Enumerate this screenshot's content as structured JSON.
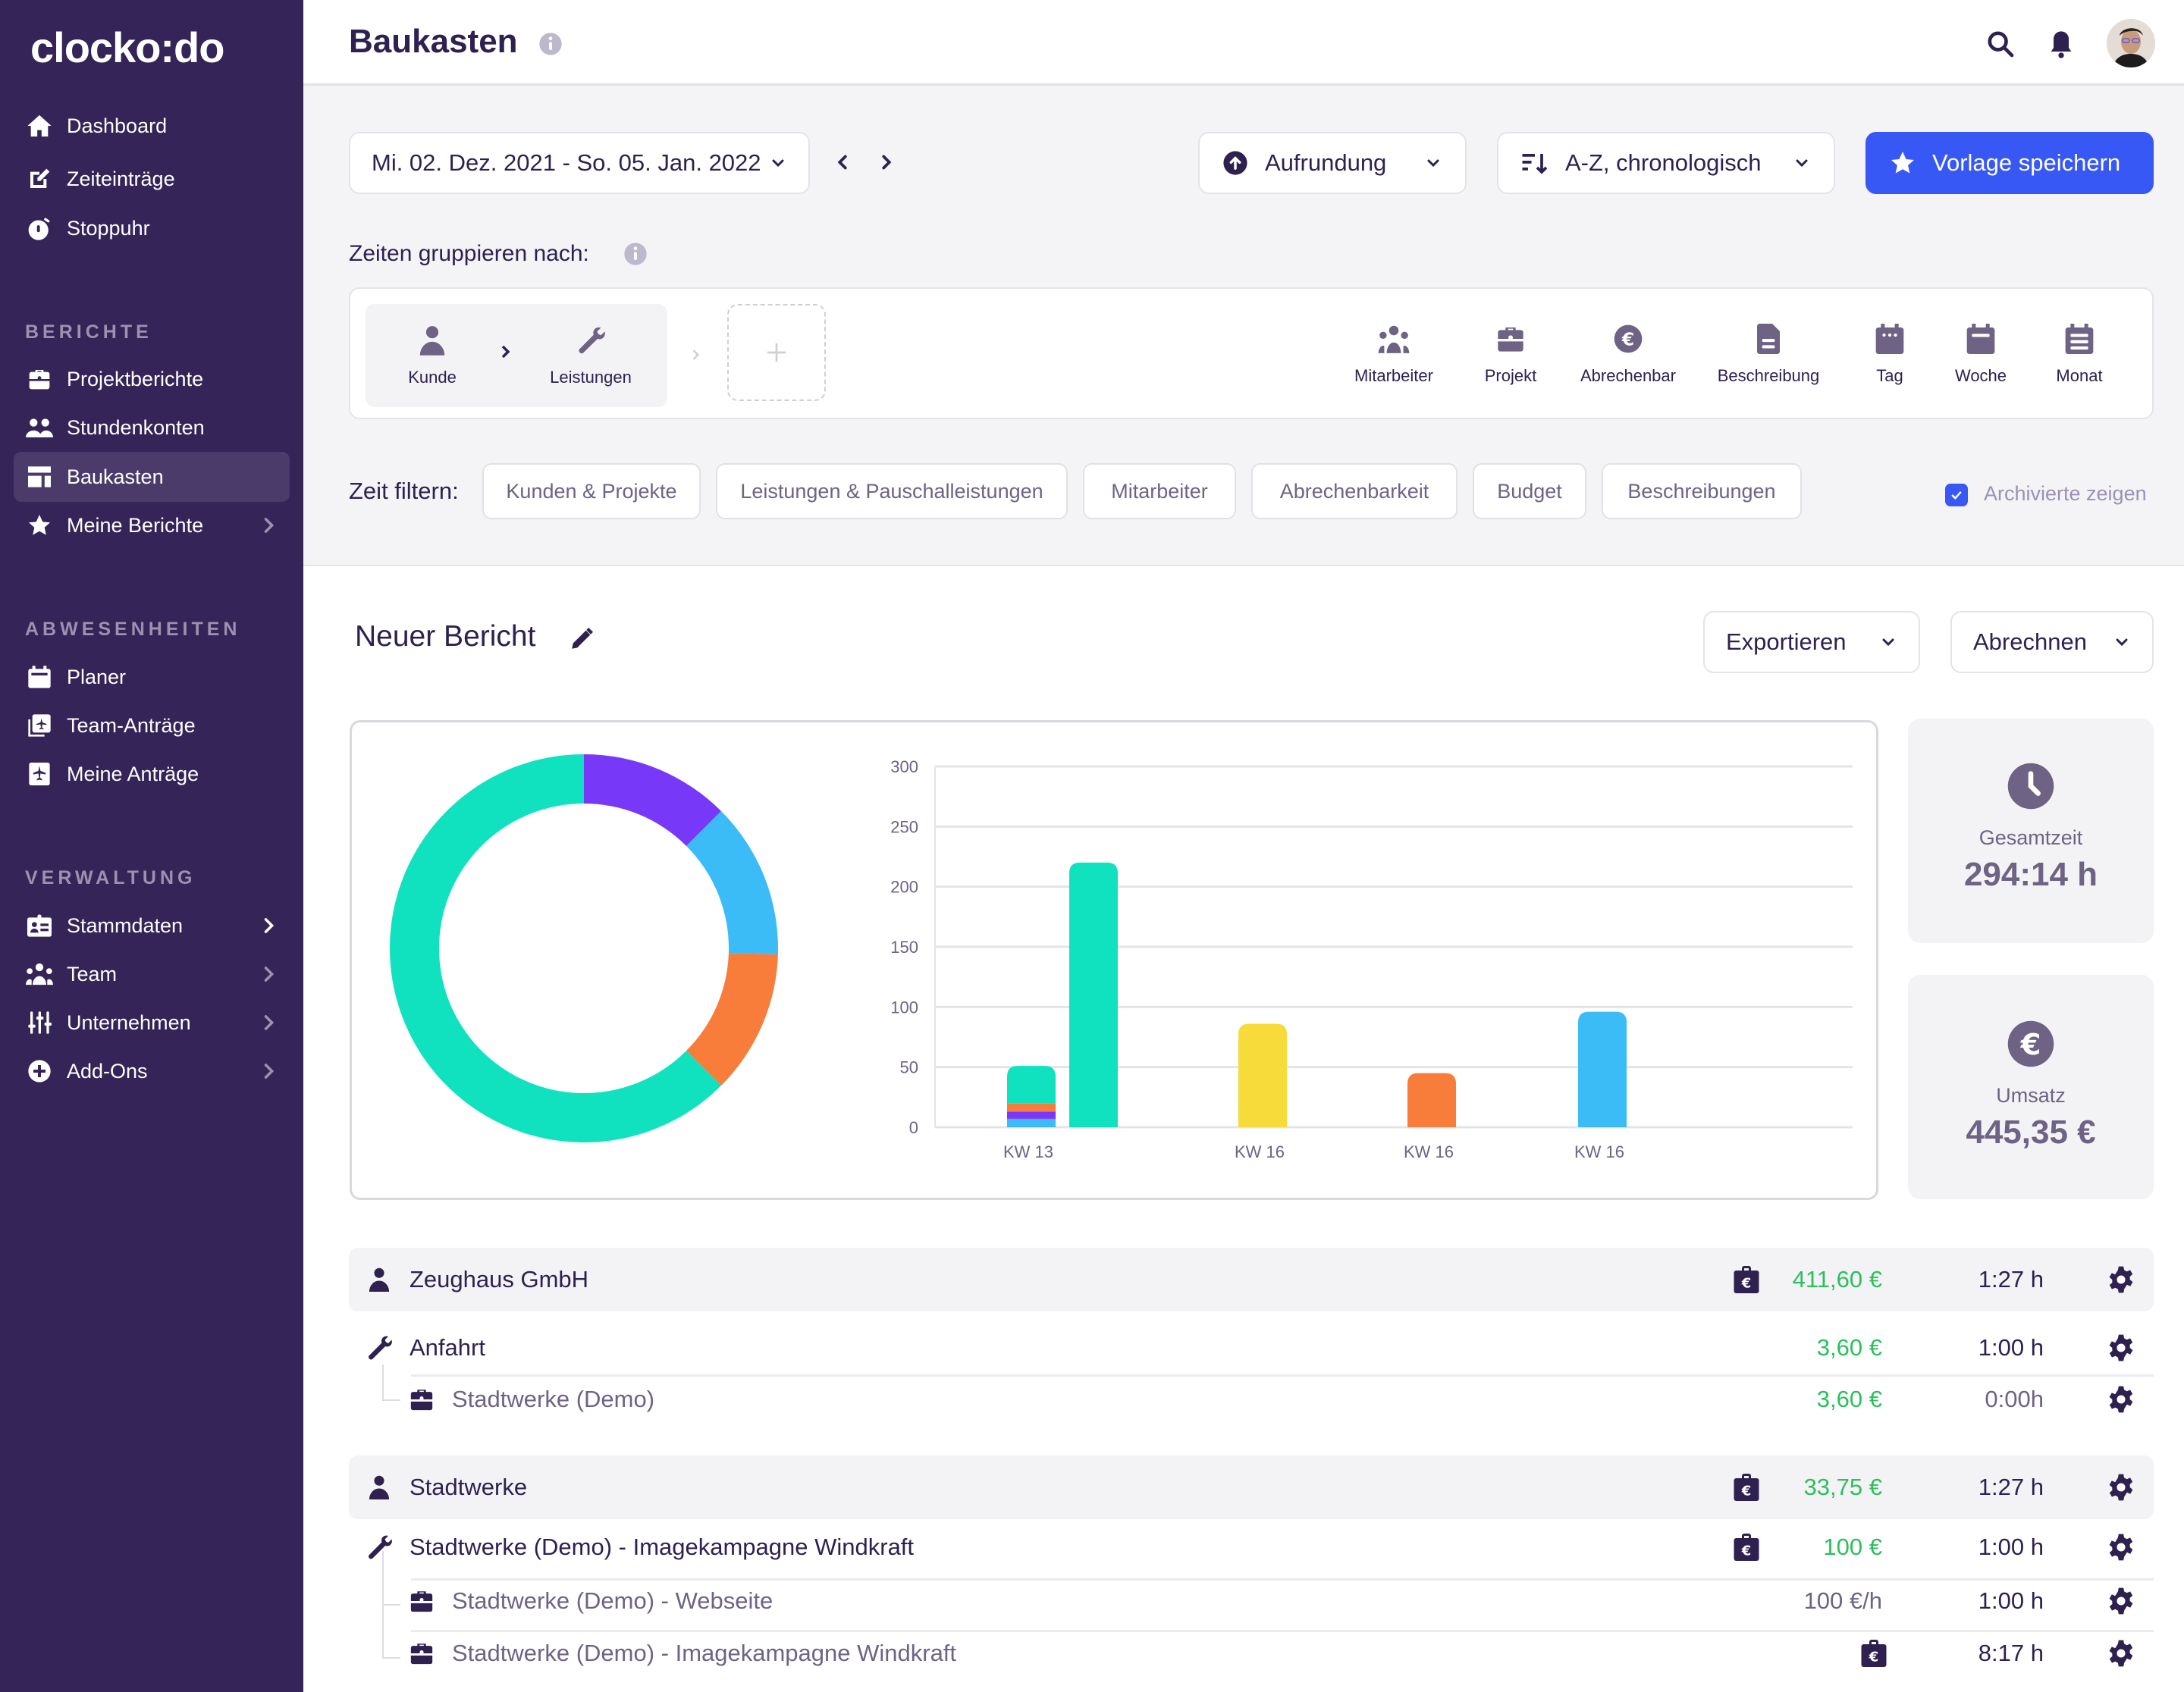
{
  "app": {
    "logo": "clocko:do",
    "page_title": "Baukasten"
  },
  "sidebar": {
    "main": [
      {
        "label": "Dashboard",
        "icon": "home-icon"
      },
      {
        "label": "Zeiteinträge",
        "icon": "edit-icon"
      },
      {
        "label": "Stoppuhr",
        "icon": "stopwatch-icon"
      }
    ],
    "sections": [
      {
        "title": "BERICHTE",
        "items": [
          {
            "label": "Projektberichte",
            "icon": "briefcase-icon"
          },
          {
            "label": "Stundenkonten",
            "icon": "users-icon"
          },
          {
            "label": "Baukasten",
            "icon": "layout-icon",
            "active": true
          },
          {
            "label": "Meine Berichte",
            "icon": "star-icon",
            "chevron": true
          }
        ]
      },
      {
        "title": "ABWESENHEITEN",
        "items": [
          {
            "label": "Planer",
            "icon": "calendar-icon"
          },
          {
            "label": "Team-Anträge",
            "icon": "team-requests-icon"
          },
          {
            "label": "Meine Anträge",
            "icon": "plane-icon"
          }
        ]
      },
      {
        "title": "VERWALTUNG",
        "items": [
          {
            "label": "Stammdaten",
            "icon": "id-card-icon",
            "chevron": true
          },
          {
            "label": "Team",
            "icon": "team-icon",
            "chevron": true
          },
          {
            "label": "Unternehmen",
            "icon": "sliders-icon",
            "chevron": true
          },
          {
            "label": "Add-Ons",
            "icon": "plus-circle-icon",
            "chevron": true
          }
        ]
      }
    ]
  },
  "toolbar": {
    "date_range": "Mi. 02. Dez. 2021 - So. 05. Jan. 2022",
    "rounding": "Aufrundung",
    "sort": "A-Z, chronologisch",
    "save_template": "Vorlage speichern"
  },
  "grouping": {
    "label": "Zeiten gruppieren nach:",
    "active": [
      {
        "label": "Kunde"
      },
      {
        "label": "Leistungen"
      }
    ],
    "available": [
      {
        "label": "Mitarbeiter"
      },
      {
        "label": "Projekt"
      },
      {
        "label": "Abrechenbar"
      },
      {
        "label": "Beschreibung"
      },
      {
        "label": "Tag"
      },
      {
        "label": "Woche"
      },
      {
        "label": "Monat"
      }
    ]
  },
  "filters": {
    "label": "Zeit filtern:",
    "chips": [
      "Kunden & Projekte",
      "Leistungen & Pauschalleistungen",
      "Mitarbeiter",
      "Abrechenbarkeit",
      "Budget",
      "Beschreibungen"
    ],
    "show_archived": {
      "label": "Archivierte zeigen",
      "checked": true
    }
  },
  "report": {
    "title": "Neuer Bericht",
    "export_label": "Exportieren",
    "bill_label": "Abrechnen"
  },
  "stats": {
    "total_time_label": "Gesamtzeit",
    "total_time": "294:14 h",
    "revenue_label": "Umsatz",
    "revenue": "445,35 €"
  },
  "colors": {
    "teal": "#10e2c0",
    "purple": "#7739f7",
    "blue": "#3bbcf7",
    "orange": "#f87c3a",
    "yellow": "#f7db3a",
    "green": "#2bbf5d",
    "accent": "#3858f6",
    "sidebar": "#352457"
  },
  "chart_data": [
    {
      "type": "pie",
      "title": "",
      "donut": true,
      "slices": [
        {
          "color": "#7739f7",
          "share": 12.5
        },
        {
          "color": "#3bbcf7",
          "share": 13
        },
        {
          "color": "#f87c3a",
          "share": 12
        },
        {
          "color": "#10e2c0",
          "share": 62.5
        }
      ]
    },
    {
      "type": "bar",
      "title": "",
      "ylim": [
        0,
        300
      ],
      "yticks": [
        0,
        50,
        100,
        150,
        200,
        250,
        300
      ],
      "grid": true,
      "bars": [
        {
          "label": "KW 13",
          "stack": [
            {
              "color": "#3bbcf7",
              "value": 7
            },
            {
              "color": "#7739f7",
              "value": 6
            },
            {
              "color": "#f87c3a",
              "value": 7
            },
            {
              "color": "#10e2c0",
              "value": 31
            }
          ]
        },
        {
          "label": "",
          "stack": [
            {
              "color": "#10e2c0",
              "value": 220
            }
          ]
        },
        {
          "label": "KW 16",
          "stack": [
            {
              "color": "#f7db3a",
              "value": 86
            }
          ]
        },
        {
          "label": "KW 16",
          "stack": [
            {
              "color": "#f87c3a",
              "value": 45
            }
          ]
        },
        {
          "label": "KW 16",
          "stack": [
            {
              "color": "#3bbcf7",
              "value": 96
            }
          ]
        }
      ]
    }
  ],
  "rows": [
    {
      "type": "group",
      "icon": "person-icon",
      "name": "Zeughaus GmbH",
      "billable_icon": true,
      "amount": "411,60 €",
      "time": "1:27 h"
    },
    {
      "type": "service",
      "icon": "wrench-icon",
      "name": "Anfahrt",
      "amount": "3,60 €",
      "time": "1:00 h"
    },
    {
      "type": "project",
      "icon": "briefcase-icon",
      "name": "Stadtwerke (Demo)",
      "amount": "3,60 €",
      "time": "0:00h",
      "time_muted": true
    },
    {
      "type": "group",
      "icon": "person-icon",
      "name": "Stadtwerke",
      "billable_icon": true,
      "amount": "33,75 €",
      "time": "1:27 h"
    },
    {
      "type": "service",
      "icon": "wrench-icon",
      "name": "Stadtwerke (Demo) - Imagekampagne Windkraft",
      "billable_icon": true,
      "amount": "100 €",
      "time": "1:00 h"
    },
    {
      "type": "project",
      "icon": "briefcase-icon",
      "name": "Stadtwerke (Demo) - Webseite",
      "amount": "100 €/h",
      "amount_muted": true,
      "time": "1:00 h"
    },
    {
      "type": "project",
      "icon": "briefcase-icon",
      "name": "Stadtwerke (Demo) - Imagekampagne Windkraft",
      "billable_icon_center": true,
      "time": "8:17 h"
    }
  ]
}
